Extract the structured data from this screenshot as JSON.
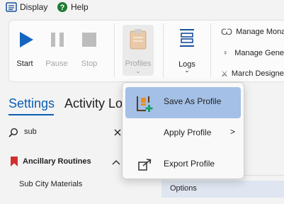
{
  "menu": {
    "display_label": "Display",
    "help_label": "Help"
  },
  "ribbon": {
    "start_label": "Start",
    "pause_label": "Pause",
    "stop_label": "Stop",
    "profiles_label": "Profiles",
    "logs_label": "Logs",
    "side_items": [
      "Manage Mona",
      "Manage Gener",
      "March Designe"
    ]
  },
  "tabs": {
    "settings": "Settings",
    "activity": "Activity Lo"
  },
  "search": {
    "value": "sub"
  },
  "section": {
    "title": "Ancillary Routines",
    "item": "Sub City Materials"
  },
  "options_label": "Options",
  "dropdown": {
    "save": "Save As Profile",
    "apply": "Apply Profile",
    "export": "Export Profile",
    "apply_arrow": ">"
  },
  "colors": {
    "accent": "#0a5fb4",
    "hover": "#a4c0e6",
    "bookmark": "#d32f2f"
  }
}
